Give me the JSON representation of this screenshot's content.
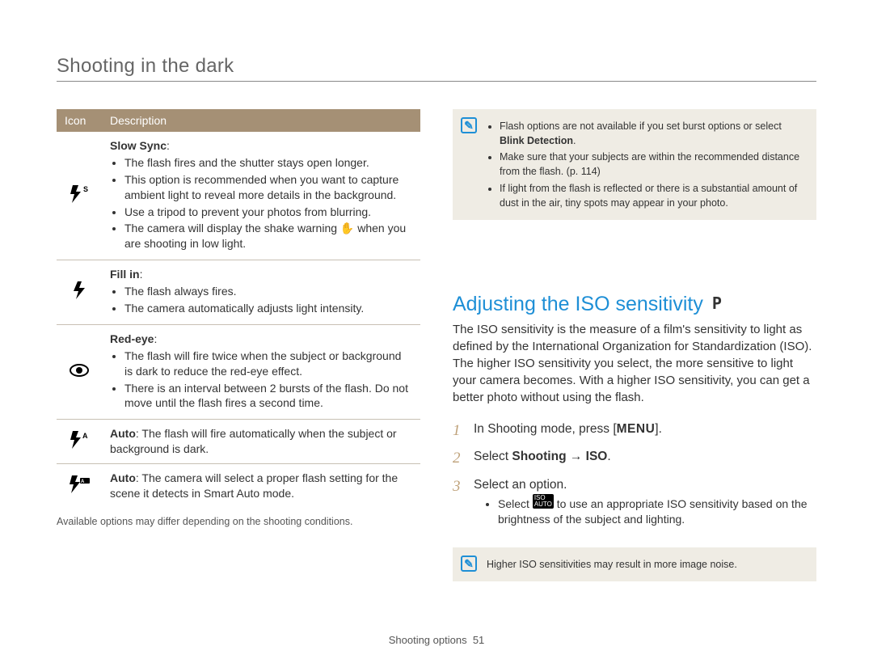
{
  "page_title": "Shooting in the dark",
  "table": {
    "headers": {
      "icon": "Icon",
      "description": "Description"
    },
    "rows": [
      {
        "icon": "slow-sync-flash-icon",
        "title": "Slow Sync",
        "items": [
          "The flash fires and the shutter stays open longer.",
          "This option is recommended when you want to capture ambient light to reveal more details in the background.",
          "Use a tripod to prevent your photos from blurring.",
          "The camera will display the shake warning ✋ when you are shooting in low light."
        ]
      },
      {
        "icon": "fill-in-flash-icon",
        "title": "Fill in",
        "items": [
          "The flash always fires.",
          "The camera automatically adjusts light intensity."
        ]
      },
      {
        "icon": "red-eye-icon",
        "title": "Red-eye",
        "items": [
          "The flash will fire twice when the subject or background is dark to reduce the red-eye effect.",
          "There is an interval between 2 bursts of the flash. Do not move until the flash fires a second time."
        ]
      },
      {
        "icon": "auto-flash-icon",
        "title": "Auto",
        "text": "The flash will fire automatically when the subject or background is dark."
      },
      {
        "icon": "smart-auto-flash-icon",
        "title": "Auto",
        "text": "The camera will select a proper flash setting for the scene it detects in Smart Auto mode."
      }
    ]
  },
  "footnote": "Available options may differ depending on the shooting conditions.",
  "note_box_1": {
    "items_pre": "Flash options are not available if you set burst options or select ",
    "items_bold": "Blink Detection",
    "items_post": ".",
    "item2": "Make sure that your subjects are within the recommended distance from the flash. (p. 114)",
    "item3": "If light from the flash is reflected or there is a substantial amount of dust in the air, tiny spots may appear in your photo."
  },
  "section_heading": "Adjusting the ISO sensitivity",
  "mode_label": "P",
  "section_paragraph": "The ISO sensitivity is the measure of a film's sensitivity to light as defined by the International Organization for Standardization (ISO). The higher ISO sensitivity you select, the more sensitive to light your camera becomes. With a higher ISO sensitivity, you can get a better photo without using the flash.",
  "steps": {
    "s1_pre": "In Shooting mode, press [",
    "s1_btn": "MENU",
    "s1_post": "].",
    "s2_pre": "Select ",
    "s2_bold": "Shooting → ISO",
    "s2_post": ".",
    "s3": "Select an option.",
    "s3_sub_pre": "Select ",
    "s3_sub_badge": "ISO AUTO",
    "s3_sub_post": " to use an appropriate ISO sensitivity based on the brightness of the subject and lighting."
  },
  "note_box_2": "Higher ISO sensitivities may result in more image noise.",
  "footer": {
    "label": "Shooting options",
    "page": "51"
  }
}
